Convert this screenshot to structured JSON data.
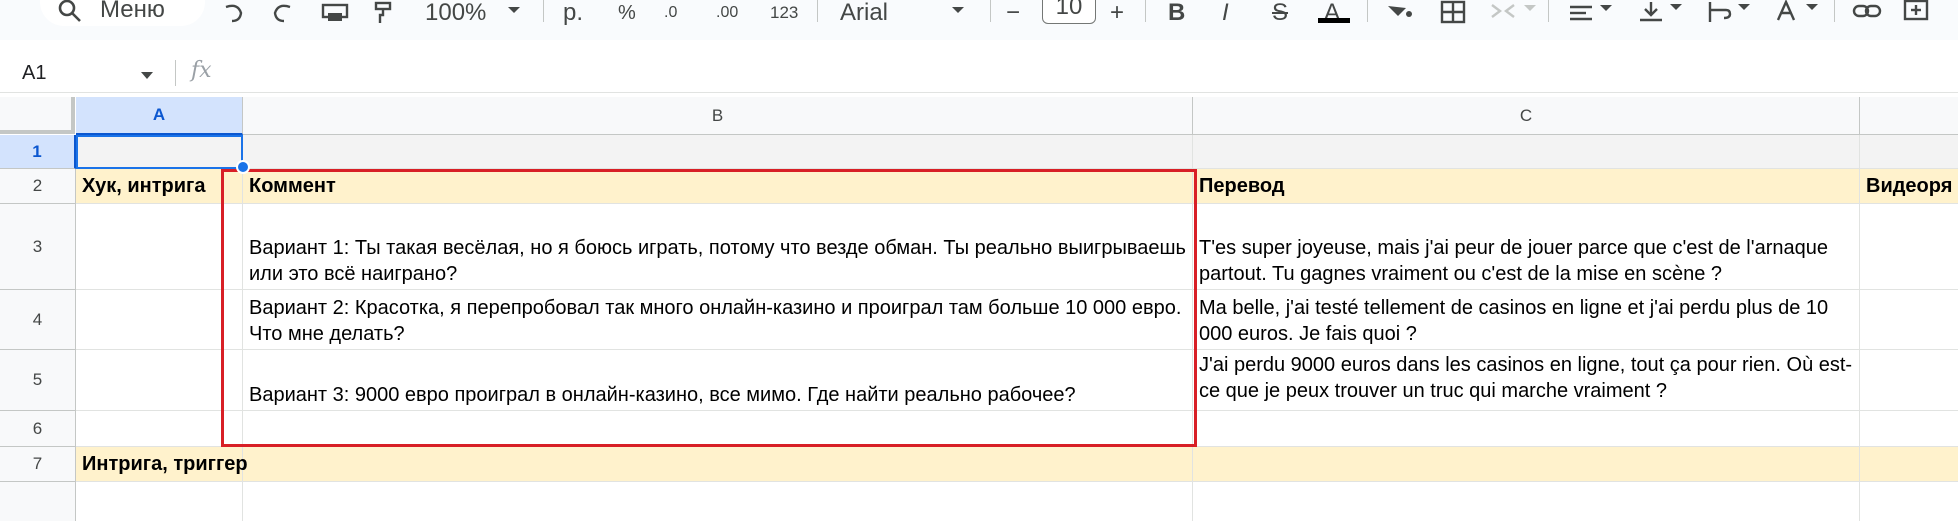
{
  "toolbar": {
    "search_label": "Меню",
    "zoom": "100%",
    "currency": "р.",
    "percent": "%",
    "decrease_decimals": ".0",
    "increase_decimals": ".00",
    "number_format": "123",
    "font": "Arial",
    "font_size": "10",
    "minus": "−",
    "plus": "+",
    "bold": "B",
    "italic": "I",
    "strikethrough": "S",
    "text_color": "A"
  },
  "formula_bar": {
    "cell_ref": "A1",
    "fx": "fx",
    "value": ""
  },
  "columns": [
    "A",
    "B",
    "C",
    ""
  ],
  "rows": [
    "1",
    "2",
    "3",
    "4",
    "5",
    "6",
    "7",
    ""
  ],
  "cells": {
    "a2": "Хук, интрига",
    "b2": "Коммент",
    "c2": "Перевод",
    "d2": "Видеоря",
    "b3": "Вариант 1: Ты такая весёлая, но я боюсь играть, потому что везде обман. Ты реально выигрываешь или это всё наиграно?",
    "c3": "T'es super joyeuse, mais j'ai peur de jouer parce que c'est de l'arnaque partout. Tu gagnes vraiment ou c'est de la mise en scène ?",
    "b4": "Вариант 2: Красотка, я перепробовал так много онлайн-казино и проиграл там больше 10 000 евро. Что мне делать?",
    "c4": "Ma belle, j'ai testé tellement de casinos en ligne et j'ai perdu plus de 10 000 euros. Je fais quoi ?",
    "b5": "Вариант 3: 9000 евро проиграл в онлайн-казино, все мимо. Где найти реально рабочее?",
    "c5": "J'ai perdu 9000 euros dans les casinos en ligne, tout ça pour rien. Où est-ce que je peux trouver un truc qui marche vraiment ?",
    "a7": "Интрига, триггер"
  },
  "colors": {
    "header_fill": "#fff2cc",
    "selection_blue": "#1a73e8",
    "highlight_red": "#d81f26"
  }
}
